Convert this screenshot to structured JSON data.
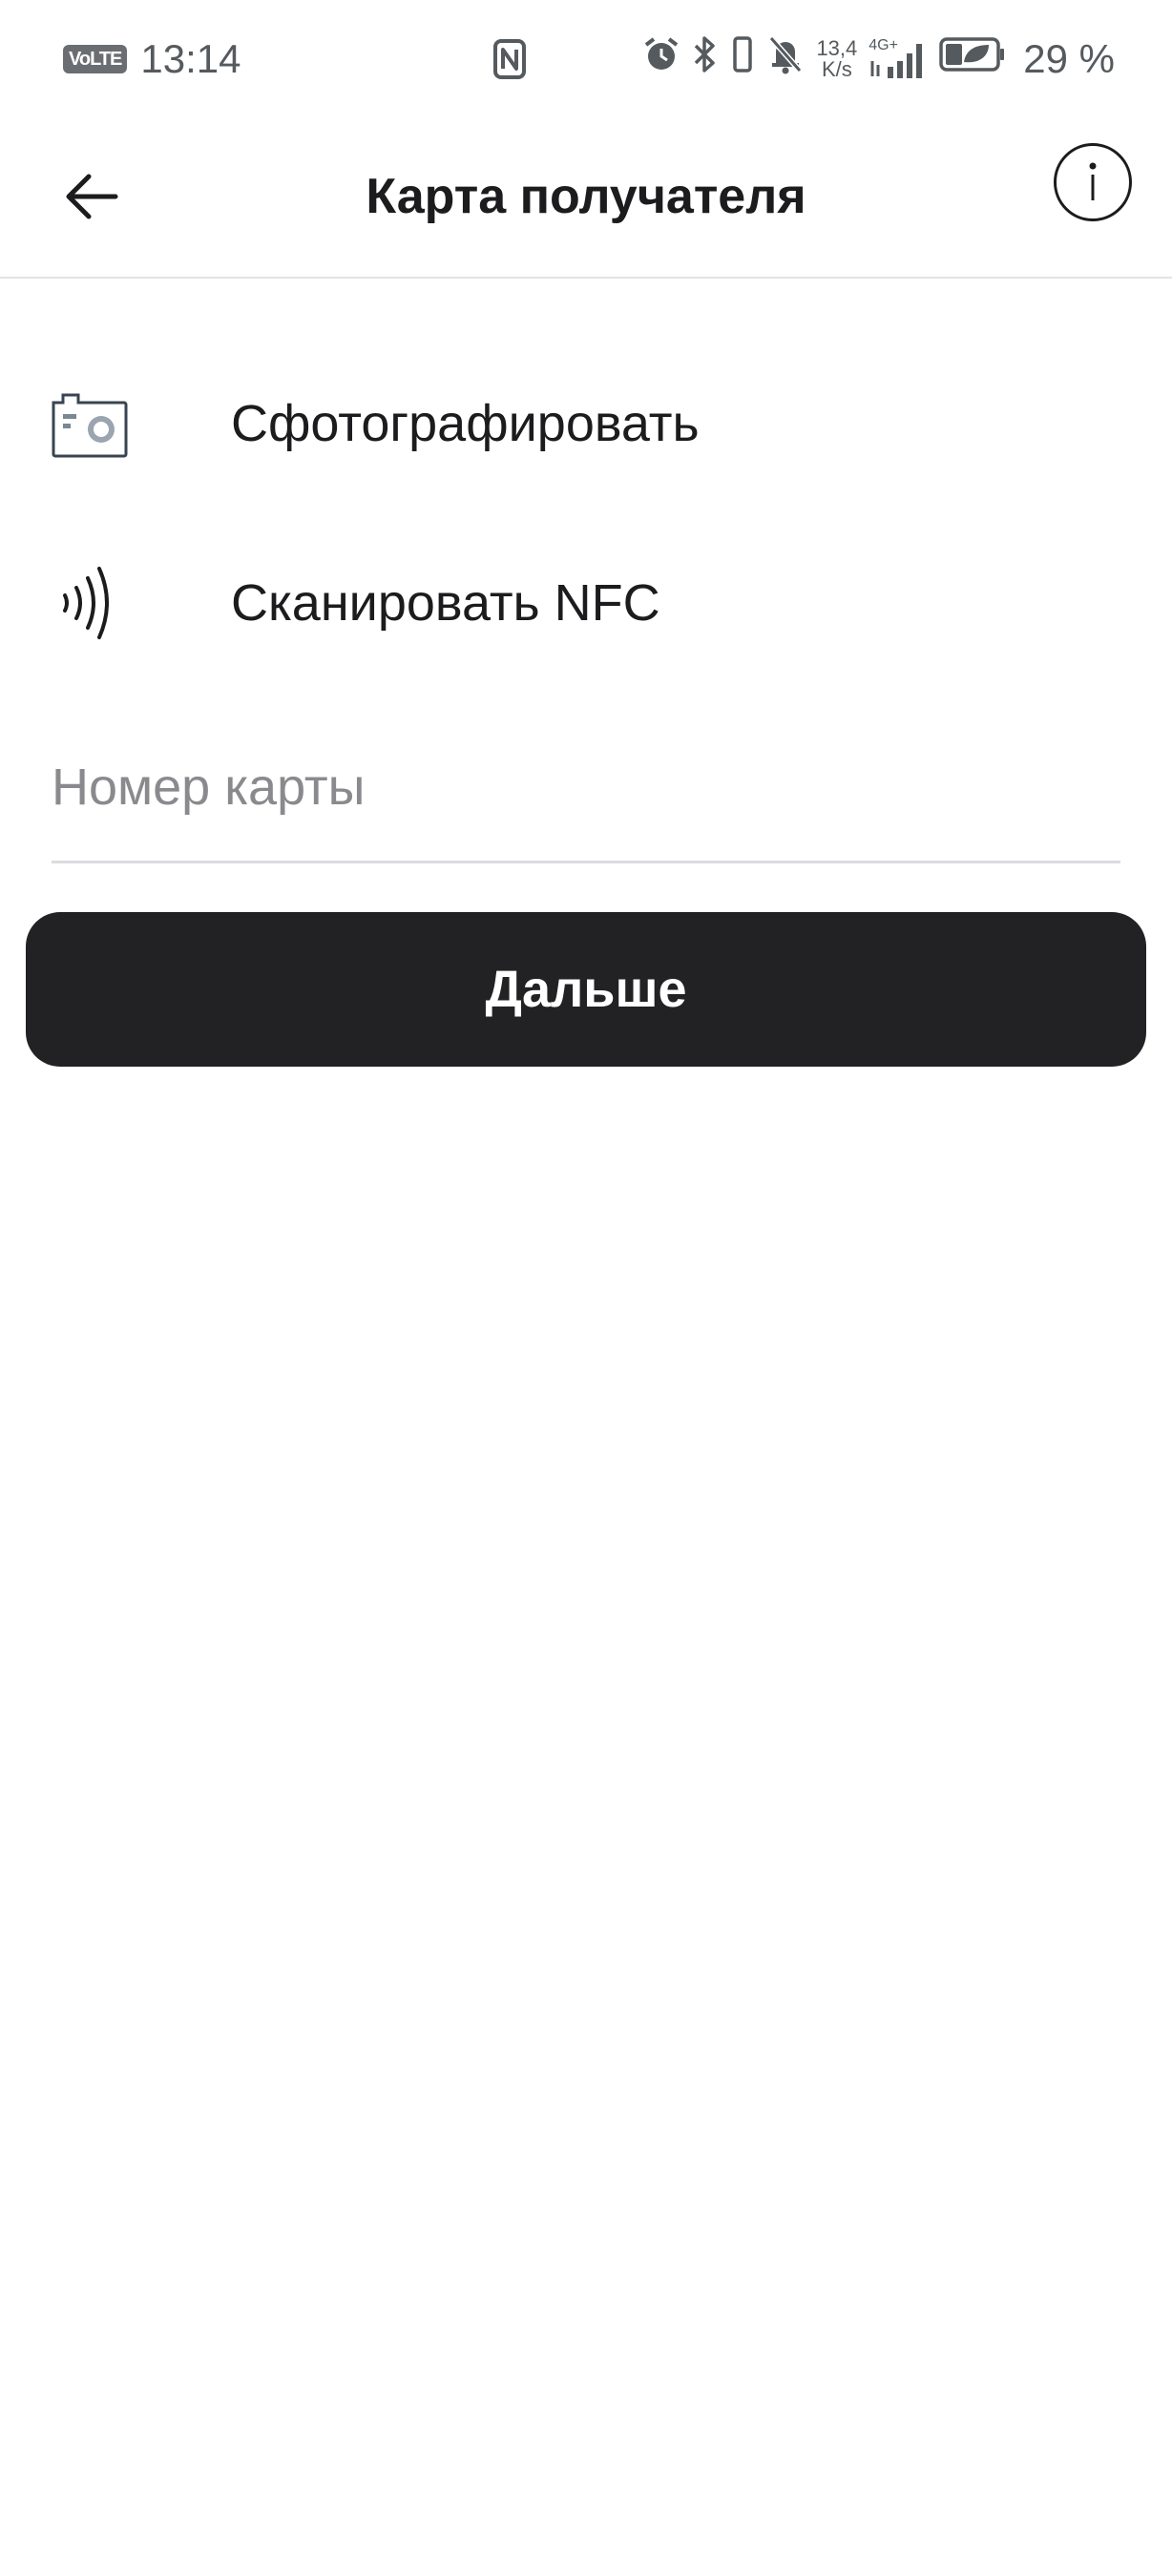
{
  "status_bar": {
    "volte": "VoLTE",
    "time": "13:14",
    "speed_value": "13,4",
    "speed_unit": "K/s",
    "network": "4G+",
    "battery": "29 %"
  },
  "header": {
    "title": "Карта получателя"
  },
  "actions": [
    {
      "label": "Сфотографировать",
      "icon": "camera-icon"
    },
    {
      "label": "Сканировать NFC",
      "icon": "nfc-icon"
    }
  ],
  "card_field": {
    "value": "",
    "placeholder": "Номер карты"
  },
  "next_button": {
    "label": "Дальше"
  },
  "colors": {
    "primary_button": "#222224",
    "text": "#1c1c1e",
    "placeholder": "#8a8a8e",
    "divider": "#e3e3e6"
  }
}
